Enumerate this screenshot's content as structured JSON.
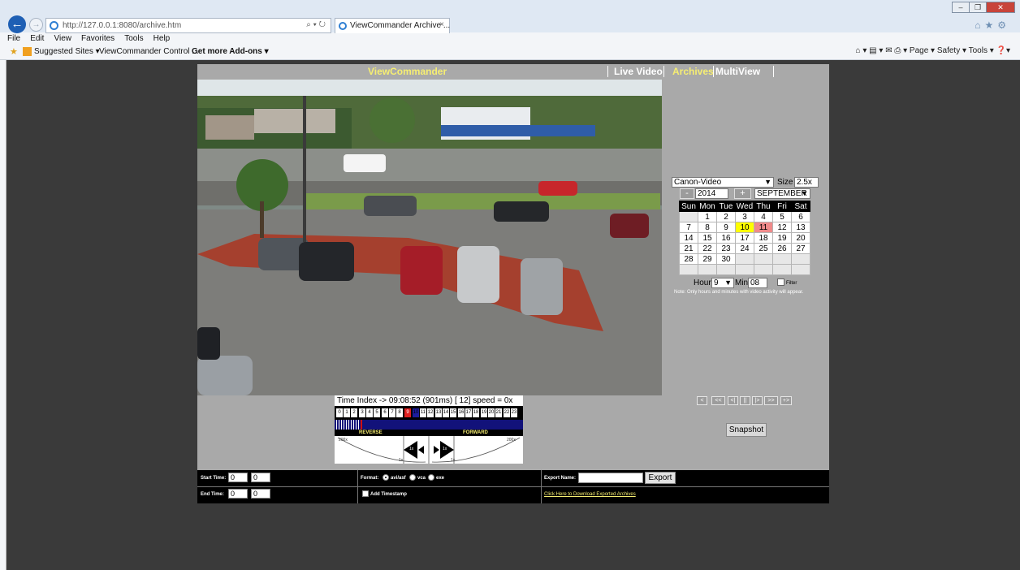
{
  "browser": {
    "url": "http://127.0.0.1:8080/archive.htm",
    "address_controls": "⌕ ▾ ↻",
    "tab_title": "ViewCommander Archive ...",
    "tab_close": "×",
    "menu": [
      "File",
      "Edit",
      "View",
      "Favorites",
      "Tools",
      "Help"
    ],
    "favorites": [
      "Suggested Sites ▾",
      "ViewCommander Control ...",
      "Get more Add-ons ▾"
    ],
    "command_bar": "⌂ ▾  ▤ ▾  ✉  ⎙ ▾  Page ▾  Safety ▾  Tools ▾  ❓▾",
    "win_min": "–",
    "win_max": "❐",
    "win_close": "✕",
    "home_icons": "⌂★⚙"
  },
  "app": {
    "logo": "ViewCommander",
    "nav": [
      "Live Video",
      "Archives",
      "MultiView"
    ],
    "active_nav": "Archives"
  },
  "camera": {
    "selected": "Canon-Video",
    "size_label": "Size",
    "size_value": "2.5x"
  },
  "calendar": {
    "year_minus": "-",
    "year": "2014",
    "year_plus": "+",
    "month": "SEPTEMBER",
    "days": [
      "Sun",
      "Mon",
      "Tue",
      "Wed",
      "Thu",
      "Fri",
      "Sat"
    ],
    "weeks": [
      [
        "",
        "1",
        "2",
        "3",
        "4",
        "5",
        "6"
      ],
      [
        "7",
        "8",
        "9",
        "10",
        "11",
        "12",
        "13"
      ],
      [
        "14",
        "15",
        "16",
        "17",
        "18",
        "19",
        "20"
      ],
      [
        "21",
        "22",
        "23",
        "24",
        "25",
        "26",
        "27"
      ],
      [
        "28",
        "29",
        "30",
        "",
        "",
        "",
        ""
      ],
      [
        "",
        "",
        "",
        "",
        "",
        "",
        ""
      ]
    ],
    "highlight_active": "10",
    "highlight_selected": "11",
    "hour_label": "Hour",
    "hour_value": "9",
    "min_label": "Min",
    "min_value": "08",
    "filter_label": "Filter",
    "note": "Note: Only hours and minutes with video activity will appear."
  },
  "playback": {
    "buttons": [
      "<",
      "<<",
      "<|",
      "||",
      "|>",
      ">>",
      "+>"
    ],
    "snapshot": "Snapshot"
  },
  "timeline": {
    "time_index": "Time Index -> 09:08:52  (901ms)  [  12] speed = 0x",
    "hours": [
      "0",
      "1",
      "2",
      "3",
      "4",
      "5",
      "6",
      "7",
      "8",
      "9",
      "10",
      "11",
      "12",
      "13",
      "14",
      "15",
      "16",
      "17",
      "18",
      "19",
      "20",
      "21",
      "22",
      "23"
    ],
    "selected_hour": "9",
    "reverse_label": "REVERSE",
    "forward_label": "FORWARD",
    "dial_left": "200x",
    "dial_right": "200x",
    "dial_min_left": "1x",
    "dial_min_right": "1x",
    "dial_1x_left": "1x",
    "dial_1x_right": "1x"
  },
  "bottom": {
    "start_time_label": "Start Time:",
    "end_time_label": "End Time:",
    "start_h": "0",
    "start_m": "0",
    "end_h": "0",
    "end_m": "0",
    "format_label": "Format:",
    "formats": [
      "avi/asf",
      "vca",
      "exe"
    ],
    "add_timestamp": "Add Timestamp",
    "export_name_label": "Export Name:",
    "export_button": "Export",
    "download_link": "Click Here to Download Exported Archives"
  }
}
